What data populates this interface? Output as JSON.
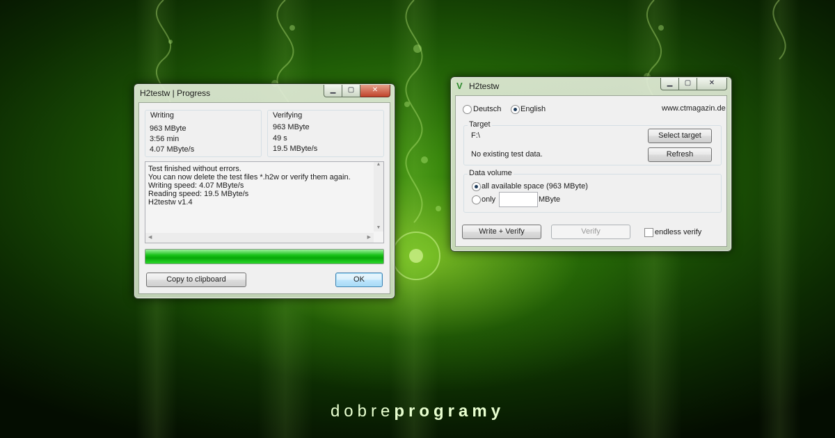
{
  "colors": {
    "accent": "#19c219",
    "background": "#2f7a0c"
  },
  "progress_window": {
    "title": "H2testw | Progress",
    "writing": {
      "label": "Writing",
      "size": "963 MByte",
      "time": "3:56 min",
      "speed": "4.07 MByte/s"
    },
    "verifying": {
      "label": "Verifying",
      "size": "963 MByte",
      "time": "49 s",
      "speed": "19.5 MByte/s"
    },
    "log": [
      "Test finished without errors.",
      "You can now delete the test files *.h2w or verify them again.",
      "Writing speed: 4.07 MByte/s",
      "Reading speed: 19.5 MByte/s",
      "H2testw v1.4"
    ],
    "progress_fraction": 1.0,
    "copy_button": "Copy to clipboard",
    "ok_button": "OK"
  },
  "main_window": {
    "title": "H2testw",
    "lang_deutsch": "Deutsch",
    "lang_english": "English",
    "selected_language": "English",
    "website": "www.ctmagazin.de",
    "target": {
      "label": "Target",
      "path": "F:\\",
      "status": "No existing test data.",
      "select_button": "Select target",
      "refresh_button": "Refresh"
    },
    "data_volume": {
      "label": "Data volume",
      "all_option": "all available space (963 MByte)",
      "only_option": "only",
      "only_value": "",
      "unit": "MByte"
    },
    "write_verify_button": "Write + Verify",
    "verify_button": "Verify",
    "endless_verify": "endless verify",
    "endless_checked": false
  },
  "branding": {
    "part1": "dobre",
    "part2": "programy"
  },
  "icons": [
    "minimize-icon",
    "maximize-icon",
    "close-icon",
    "h2testw-logo-icon"
  ]
}
